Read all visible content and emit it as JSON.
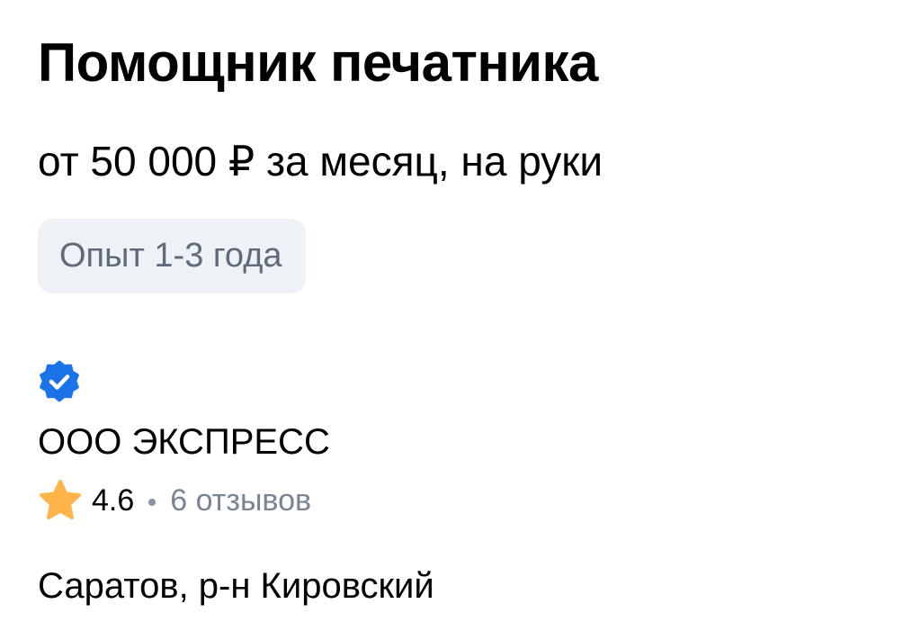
{
  "vacancy": {
    "title": "Помощник печатника",
    "salary": "от 50 000 ₽ за месяц, на руки",
    "experience": "Опыт 1-3 года"
  },
  "employer": {
    "verified_icon": "verified-badge-icon",
    "verified_color": "#1a73e8",
    "name": "ООО ЭКСПРЕСС",
    "rating": {
      "star_icon": "star-icon",
      "star_color": "#ffb44a",
      "value": "4.6",
      "reviews": "6 отзывов"
    }
  },
  "location": {
    "address": "Саратов, р-н Кировский"
  }
}
